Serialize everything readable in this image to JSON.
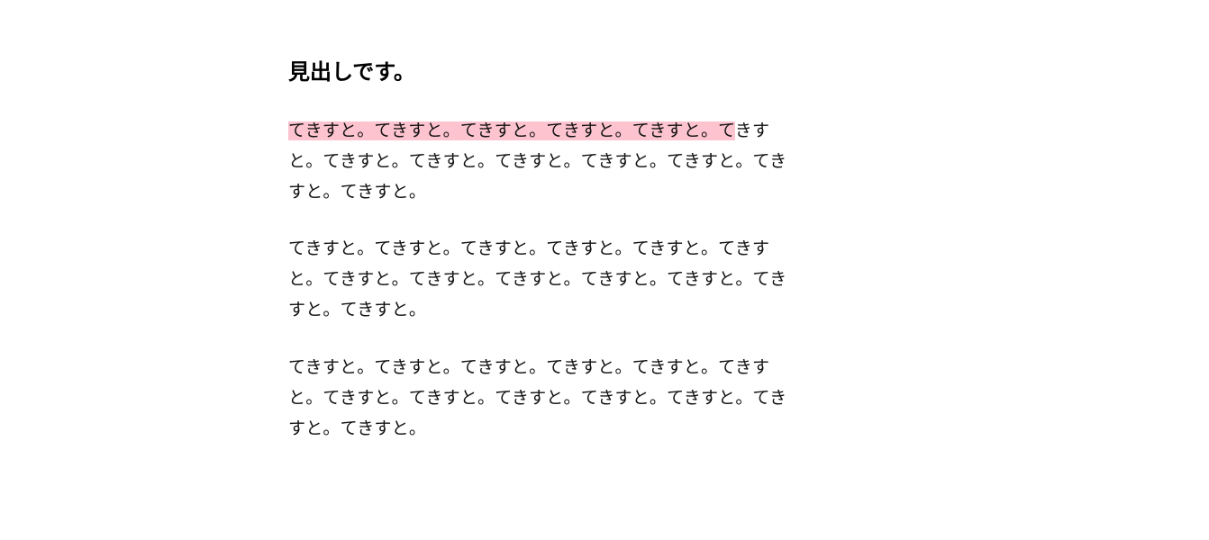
{
  "heading": "見出しです。",
  "paragraphs": [
    {
      "highlighted_first_line": "てきすと。てきすと。てきすと。てきすと。てきすと。て",
      "rest": "きすと。てきすと。てきすと。てきすと。てきすと。てきすと。てきすと。てきすと。"
    },
    {
      "text": "てきすと。てきすと。てきすと。てきすと。てきすと。てきすと。てきすと。てきすと。てきすと。てきすと。てきすと。てきすと。てきすと。"
    },
    {
      "text": "てきすと。てきすと。てきすと。てきすと。てきすと。てきすと。てきすと。てきすと。てきすと。てきすと。てきすと。てきすと。てきすと。"
    }
  ],
  "colors": {
    "highlight": "#fdc4cf"
  }
}
